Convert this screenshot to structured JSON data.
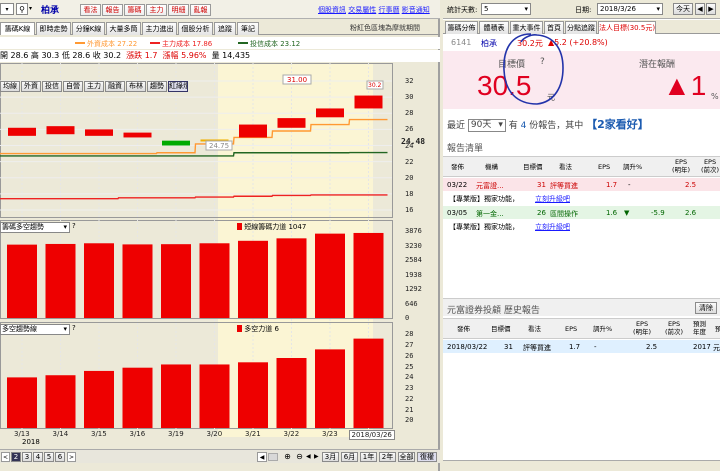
{
  "left": {
    "toolbar": {
      "symbol_name": "柏承",
      "buttons": [
        "看法",
        "報告",
        "籌碼",
        "主力",
        "明細",
        "亂報"
      ],
      "links": [
        "個股資訊",
        "交易屬性",
        "行事曆",
        "影音通知"
      ]
    },
    "tabs": [
      "籌碼K線",
      "即時走勢",
      "分鐘K線",
      "大量多筒",
      "主力進出",
      "個股分析",
      "追蹤",
      "筆記"
    ],
    "tab_note": "粉紅色區塊為摩就期間",
    "legend": [
      {
        "label": "外資成本 27.22",
        "color": "#ff9933"
      },
      {
        "label": "主力成本 17.86",
        "color": "#ee2222"
      },
      {
        "label": "投信成本 23.12",
        "color": "#226622"
      }
    ],
    "quote": {
      "open_label": "開",
      "open": "28.6",
      "high_label": "高",
      "high": "30.3",
      "low_label": "低",
      "low": "28.6",
      "close_label": "收",
      "close": "30.2",
      "change_label": "漲跌",
      "change": "1.7",
      "pct_label": "漲幅",
      "pct": "5.96%",
      "vol_label": "量",
      "vol": "14,435"
    },
    "indicator_buttons": [
      "均線",
      "外資",
      "投信",
      "自營",
      "主力",
      "融資",
      "布林",
      "趨勢",
      "紅綠燈"
    ],
    "main_y_ticks": [
      "32",
      "30",
      "28",
      "26",
      "24",
      "22",
      "20",
      "18",
      "16"
    ],
    "price_marker": "24.48",
    "tooltip_high": "31.00",
    "tooltip_low": "24.75",
    "panel2": {
      "title": "籌碼多空趨勢",
      "label": "短線籌碼力道 1047",
      "y_ticks": [
        "3876",
        "3230",
        "2584",
        "1938",
        "1292",
        "646",
        "0"
      ]
    },
    "panel3": {
      "title": "多空趨勢線",
      "label": "多空力道 6",
      "y_ticks": [
        "28",
        "27",
        "26",
        "25",
        "24",
        "23",
        "22",
        "21",
        "20"
      ]
    },
    "x_ticks": [
      "3/13",
      "3/14",
      "3/15",
      "3/16",
      "3/19",
      "3/20",
      "3/21",
      "3/22",
      "3/23",
      "2018/03/26"
    ],
    "x_year": "2018",
    "bottom": {
      "pages": [
        "2",
        "3",
        "4",
        "5",
        "6"
      ],
      "ranges": [
        "3月",
        "6月",
        "1年",
        "2年",
        "全部",
        "復權"
      ]
    }
  },
  "right": {
    "top": {
      "days_label": "統計天數:",
      "days_value": "5",
      "date_label": "日期:",
      "date_value": "2018/3/26",
      "today_btn": "今天"
    },
    "tabs": [
      "籌碼分佈",
      "體積表",
      "重大事件",
      "首頁",
      "分點追蹤",
      "法人目標(30.5元)"
    ],
    "stock": {
      "code": "6141",
      "name": "柏承",
      "price": "30.2元",
      "change": "▲5.2 (+20.8%)"
    },
    "target": {
      "label": "目標價",
      "help": "?",
      "value": "30.5",
      "unit": "元",
      "upside_label": "潛在報酬",
      "upside": "▲1",
      "upside_unit": "%"
    },
    "recent": {
      "prefix": "最近",
      "period": "90天",
      "mid1": "有",
      "count": "4",
      "mid2": "份報告，其中",
      "highlight": "【2家看好】"
    },
    "report_list": {
      "title": "報告清單",
      "headers": [
        "發佈",
        "機構",
        "目標價",
        "看法",
        "EPS",
        "調升%",
        "EPS\n(明年)",
        "EPS\n(前次)"
      ],
      "rows": [
        {
          "date": "03/22",
          "inst": "元富證...",
          "target": "31",
          "view": "評等買進",
          "eps": "1.7",
          "arrow": "-",
          "up": "",
          "eps_next": "2.5",
          "eps_prev": ""
        },
        {
          "note": "【專業版】獨家功能，",
          "link": "立刻升級吧"
        },
        {
          "date": "03/05",
          "inst": "第一金...",
          "target": "26",
          "view": "區間操作",
          "eps": "1.6",
          "arrow": "▼",
          "up": "-5.9",
          "eps_next": "2.6",
          "eps_prev": ""
        },
        {
          "note": "【專業版】獨家功能，",
          "link": "立刻升級吧"
        }
      ]
    },
    "history": {
      "title": "元富證券投顧 歷史報告",
      "clear_btn": "清除",
      "headers": [
        "發佈",
        "目標價",
        "看法",
        "EPS",
        "調升%",
        "EPS\n(明年)",
        "EPS\n(前次)",
        "預測\n年度",
        "預"
      ],
      "row": {
        "date": "2018/03/22",
        "target": "31",
        "view": "評等買進",
        "eps": "1.7",
        "up": "-",
        "eps_next": "2.5",
        "eps_prev": "",
        "year": "2017",
        "extra": "元"
      }
    }
  },
  "chart_data": [
    {
      "type": "candlestick",
      "categories": [
        "3/13",
        "3/14",
        "3/15",
        "3/16",
        "3/19",
        "3/20",
        "3/21",
        "3/22",
        "3/23",
        "3/26"
      ],
      "open": [
        25.2,
        25.4,
        25.2,
        25.0,
        24.6,
        24.5,
        25.0,
        26.2,
        27.5,
        28.6
      ],
      "close": [
        26.2,
        26.4,
        26.0,
        25.6,
        24.0,
        24.75,
        26.6,
        27.4,
        28.6,
        30.2
      ],
      "ylim": [
        15,
        33
      ],
      "series": [
        {
          "name": "外資成本",
          "color": "#ff9933",
          "values": [
            23.0,
            23.0,
            23.0,
            23.0,
            23.1,
            24.2,
            25.0,
            25.8,
            26.6,
            27.22
          ]
        },
        {
          "name": "投信成本",
          "color": "#226622",
          "values": [
            22.7,
            22.7,
            22.7,
            22.7,
            22.7,
            22.7,
            23.1,
            23.1,
            23.1,
            23.12
          ]
        },
        {
          "name": "主力成本",
          "color": "#ee2222",
          "values": [
            17.4,
            17.4,
            17.4,
            17.5,
            17.5,
            17.6,
            17.7,
            17.8,
            17.86,
            17.86
          ]
        }
      ]
    },
    {
      "type": "bar",
      "categories": [
        "3/13",
        "3/14",
        "3/15",
        "3/16",
        "3/19",
        "3/20",
        "3/21",
        "3/22",
        "3/23",
        "3/26"
      ],
      "values": [
        3270,
        3300,
        3330,
        3280,
        3290,
        3330,
        3440,
        3550,
        3760,
        3790
      ],
      "ylim": [
        0,
        4100
      ]
    },
    {
      "type": "bar",
      "categories": [
        "3/13",
        "3/14",
        "3/15",
        "3/16",
        "3/19",
        "3/20",
        "3/21",
        "3/22",
        "3/23",
        "3/26"
      ],
      "values": [
        24.0,
        24.2,
        24.6,
        24.9,
        25.2,
        25.2,
        25.4,
        25.8,
        26.6,
        27.6
      ],
      "ylim": [
        19.3,
        28.4
      ]
    }
  ]
}
